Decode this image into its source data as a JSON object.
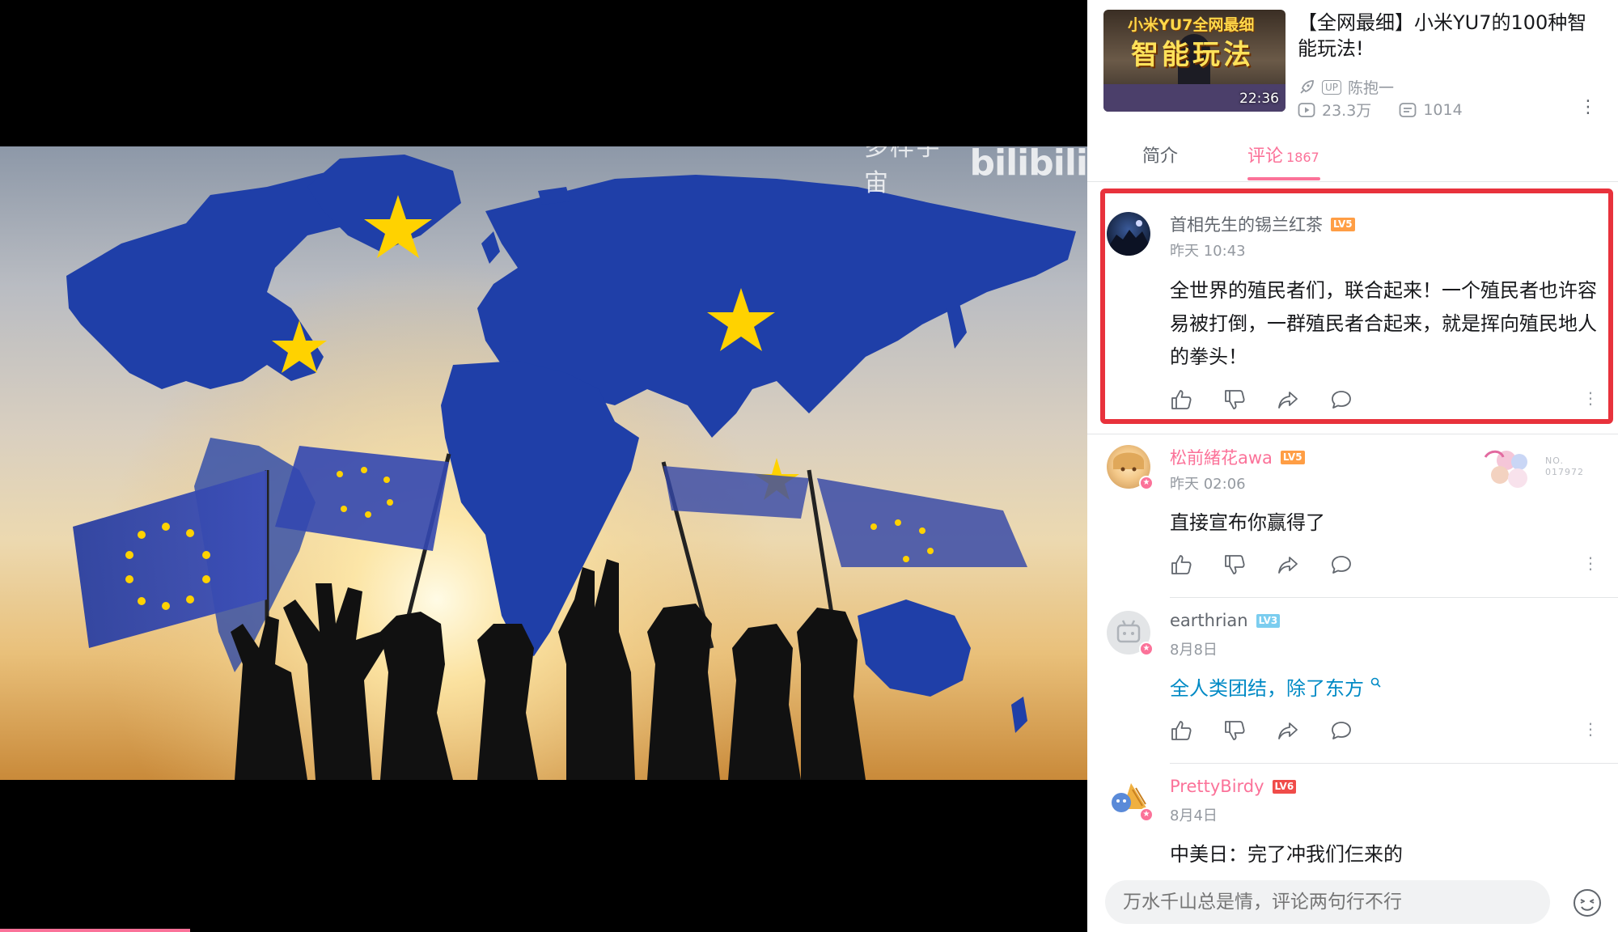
{
  "player": {
    "watermark_text": "多样宇宙",
    "watermark_logo": "bilibili",
    "progress_fraction": 0.175,
    "accent": "#fb7299"
  },
  "related": {
    "thumb_top": "小米YU7全网最细",
    "thumb_main": "智能玩法",
    "duration": "22:36",
    "title": "【全网最细】小米YU7的100种智能玩法!",
    "up_badge": "UP",
    "author": "陈抱一",
    "views": "23.3万",
    "danmaku": "1014"
  },
  "tabs": {
    "intro": "简介",
    "comments": "评论",
    "comments_count": "1867"
  },
  "comments": [
    {
      "user": "首相先生的锡兰红茶",
      "level": "LV5",
      "time": "昨天 10:43",
      "text": "全世界的殖民者们，联合起来！一个殖民者也许容易被打倒，一群殖民者合起来，就是挥向殖民地人的拳头！"
    },
    {
      "user": "松前緒花awa",
      "level": "LV5",
      "time": "昨天 02:06",
      "text": "直接宣布你赢得了",
      "fan_code": "NO.\n017972"
    },
    {
      "user": "earthrian",
      "level": "LV3",
      "time": "8月8日",
      "text": "全人类团结，除了东方"
    },
    {
      "user": "PrettyBirdy",
      "level": "LV6",
      "time": "8月4日",
      "text": "中美日：完了冲我们仨来的"
    }
  ],
  "input": {
    "placeholder": "万水千山总是情，评论两句行不行"
  },
  "colors": {
    "pink": "#fb7299",
    "highlight": "#e8323c",
    "link": "#008ac5",
    "eu_blue": "#1f3fa8",
    "star_yellow": "#ffd200"
  }
}
